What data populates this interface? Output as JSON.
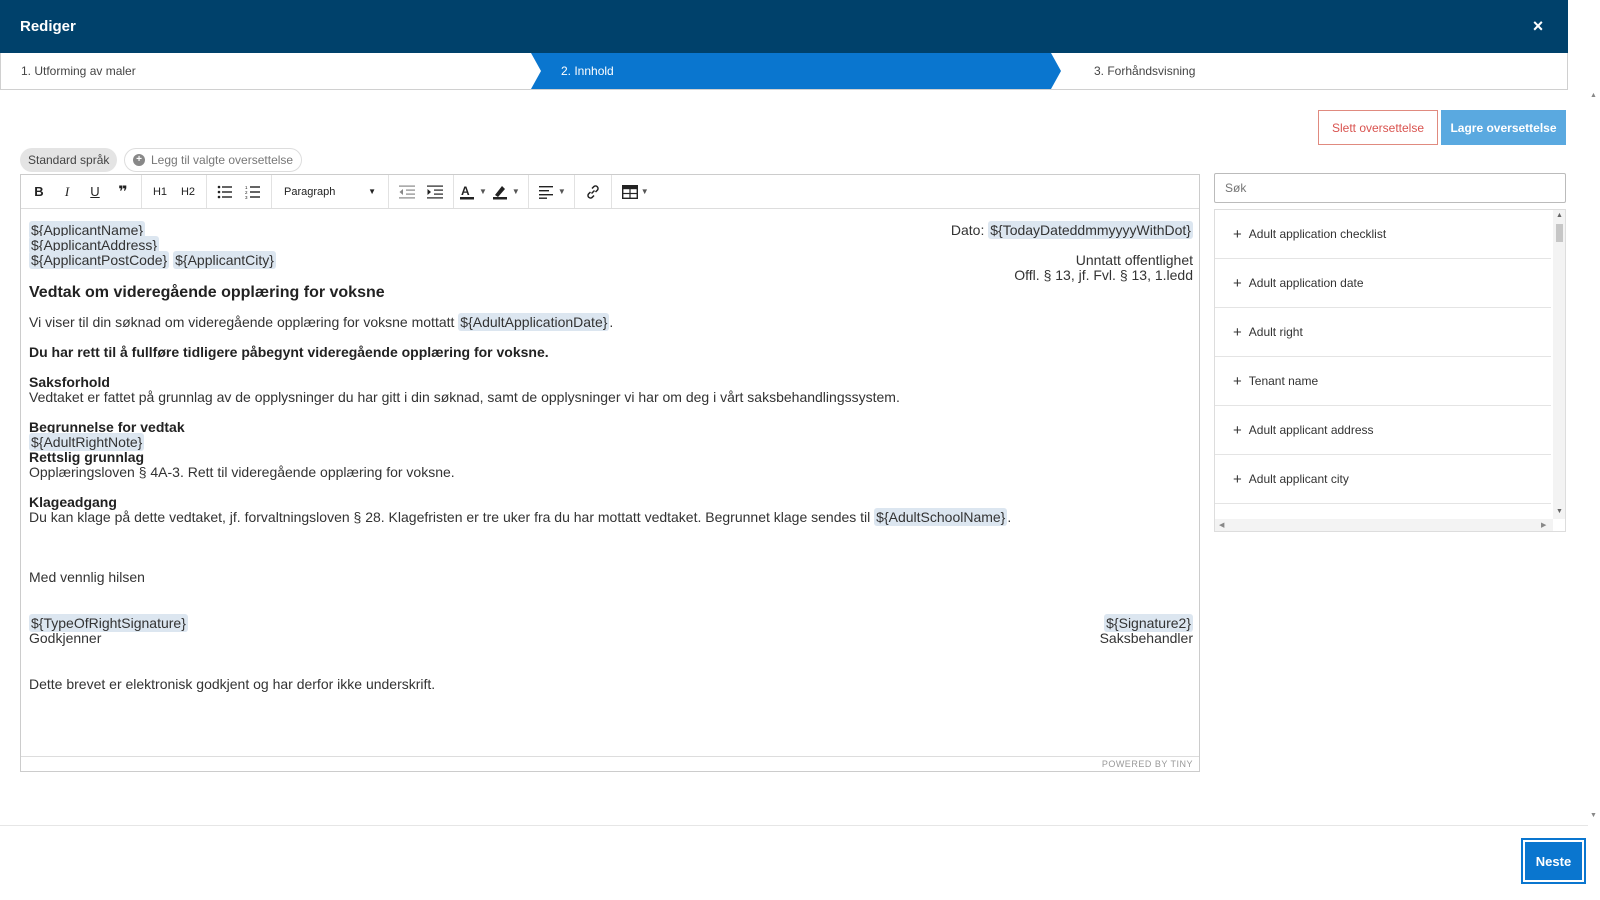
{
  "header": {
    "title": "Rediger",
    "close_label": "×"
  },
  "stepper": {
    "steps": [
      {
        "label": "1. Utforming av maler",
        "active": false
      },
      {
        "label": "2. Innhold",
        "active": true
      },
      {
        "label": "3. Forhåndsvisning",
        "active": false
      }
    ],
    "active_color": "#0a76cf"
  },
  "actions": {
    "delete_label": "Slett oversettelse",
    "save_label": "Lagre oversettelse"
  },
  "languages": {
    "standard_label": "Standard språk",
    "add_label": "Legg til valgte oversettelse"
  },
  "toolbar": {
    "bold": "B",
    "italic": "I",
    "underline": "U",
    "quote": "❞",
    "h1": "H1",
    "h2": "H2",
    "block_format": "Paragraph"
  },
  "document": {
    "applicant_name": "${ApplicantName}",
    "applicant_address": "${ApplicantAddress}",
    "applicant_postcode": "${ApplicantPostCode}",
    "applicant_city": "${ApplicantCity}",
    "date_label": "Dato:",
    "date_tag": "${TodayDateddmmyyyyWithDot}",
    "exempt_line1": "Unntatt offentlighet",
    "exempt_line2": "Offl. § 13, jf. Fvl. § 13, 1.ledd",
    "heading": "Vedtak om videregående opplæring for voksne",
    "intro_text": "Vi viser til din søknad om videregående opplæring for voksne mottatt",
    "intro_tag": "${AdultApplicationDate}",
    "intro_end": ".",
    "right_statement": "Du har rett til å fullføre tidligere påbegynt videregående opplæring for voksne.",
    "case_heading": "Saksforhold",
    "case_text": "Vedtaket er fattet på grunnlag av de opplysninger du har gitt i din søknad, samt de opplysninger vi har om deg i vårt saksbehandlingssystem.",
    "reason_heading": "Begrunnelse for vedtak",
    "reason_tag": "${AdultRightNote}",
    "legal_heading": "Rettslig grunnlag",
    "legal_text": "Opplæringsloven § 4A-3. Rett til videregående opplæring for voksne.",
    "appeal_heading": "Klageadgang",
    "appeal_text": "Du kan klage på dette vedtaket, jf. forvaltningsloven § 28. Klagefristen er tre uker fra du har mottatt vedtaket. Begrunnet klage sendes til",
    "appeal_tag": "${AdultSchoolName}",
    "appeal_end": ".",
    "greeting": "Med vennlig hilsen",
    "sig1_tag": "${TypeOfRightSignature}",
    "sig1_role": "Godkjenner",
    "sig2_tag": "${Signature2}",
    "sig2_role": "Saksbehandler",
    "footer_note": "Dette brevet er elektronisk godkjent og har derfor ikke underskrift."
  },
  "editor_brand": "POWERED BY TINY",
  "side_panel": {
    "search_placeholder": "Søk",
    "items": [
      "Adult application checklist",
      "Adult application date",
      "Adult right",
      "Tenant name",
      "Adult applicant address",
      "Adult applicant city"
    ]
  },
  "footer": {
    "next_label": "Neste"
  },
  "colors": {
    "header_bg": "#00416b",
    "primary": "#0a76cf",
    "save_btn": "#5aa9e0",
    "delete_text": "#d9534f",
    "tag_bg": "#dce6f0"
  }
}
